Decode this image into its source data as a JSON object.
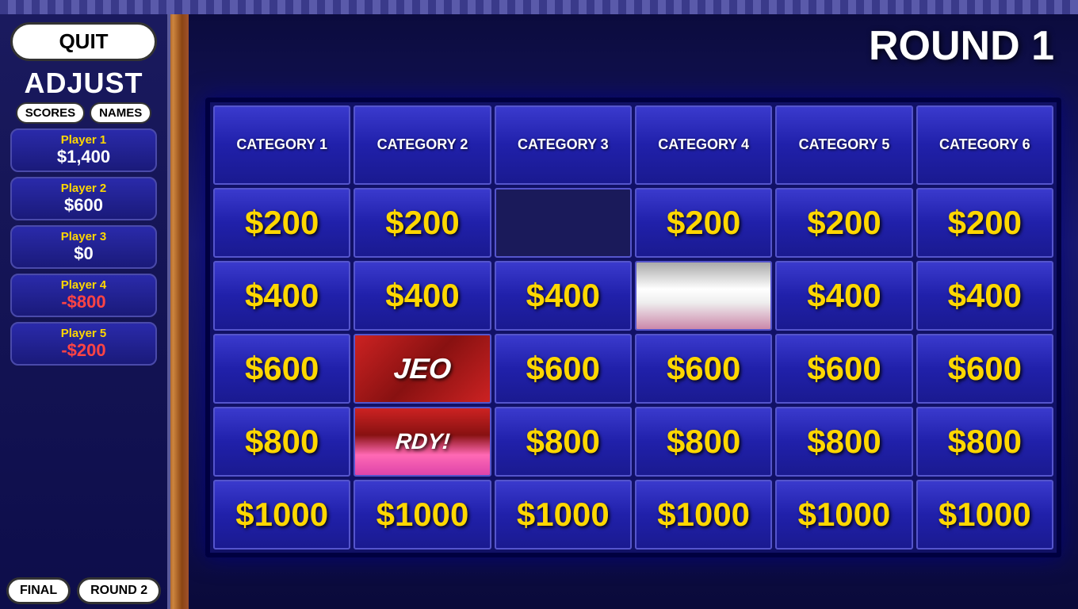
{
  "app": {
    "round_title": "ROUND 1"
  },
  "sidebar": {
    "quit_label": "QUIT",
    "adjust_label": "ADJUST",
    "scores_label": "SCORES",
    "names_label": "NAMES",
    "players": [
      {
        "name": "Player 1",
        "score": "$1,400",
        "negative": false
      },
      {
        "name": "Player 2",
        "score": "$600",
        "negative": false
      },
      {
        "name": "Player 3",
        "score": "$0",
        "negative": false
      },
      {
        "name": "Player 4",
        "score": "-$800",
        "negative": true
      },
      {
        "name": "Player 5",
        "score": "-$200",
        "negative": true
      }
    ],
    "final_label": "FINAL",
    "round2_label": "ROUND 2"
  },
  "board": {
    "categories": [
      "CATEGORY 1",
      "CATEGORY 2",
      "CATEGORY 3",
      "CATEGORY 4",
      "CATEGORY 5",
      "CATEGORY 6"
    ],
    "rows": [
      {
        "values": [
          "$200",
          "$200",
          null,
          "$200",
          "$200",
          "$200"
        ],
        "cell_types": [
          "normal",
          "normal",
          "empty",
          "normal",
          "normal",
          "normal"
        ]
      },
      {
        "values": [
          "$400",
          "$400",
          "$400",
          null,
          "$400",
          "$400"
        ],
        "cell_types": [
          "normal",
          "normal",
          "normal",
          "media2",
          "normal",
          "normal"
        ]
      },
      {
        "values": [
          "$600",
          null,
          "$600",
          "$600",
          "$600",
          "$600"
        ],
        "cell_types": [
          "normal",
          "media1",
          "normal",
          "normal",
          "normal",
          "normal"
        ]
      },
      {
        "values": [
          "$800",
          null,
          "$800",
          "$800",
          "$800",
          "$800"
        ],
        "cell_types": [
          "normal",
          "media1b",
          "normal",
          "normal",
          "normal",
          "normal"
        ]
      },
      {
        "values": [
          "$1000",
          "$1000",
          "$1000",
          "$1000",
          "$1000",
          "$1000"
        ],
        "cell_types": [
          "normal",
          "normal",
          "normal",
          "normal",
          "normal",
          "normal"
        ]
      }
    ]
  }
}
